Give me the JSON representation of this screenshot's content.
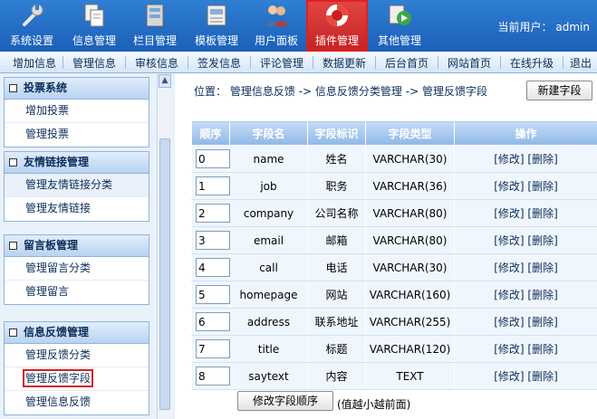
{
  "nav": {
    "items": [
      {
        "label": "系统设置",
        "icon": "wrench-icon"
      },
      {
        "label": "信息管理",
        "icon": "documents-icon"
      },
      {
        "label": "栏目管理",
        "icon": "column-icon"
      },
      {
        "label": "模板管理",
        "icon": "template-icon"
      },
      {
        "label": "用户面板",
        "icon": "users-icon"
      },
      {
        "label": "插件管理",
        "icon": "lifebuoy-icon"
      },
      {
        "label": "其他管理",
        "icon": "media-icon"
      }
    ],
    "active": "插件管理",
    "user_prefix": "当前用户：",
    "user_name": "admin"
  },
  "submenu": {
    "items": [
      "增加信息",
      "管理信息",
      "审核信息",
      "签发信息",
      "评论管理",
      "数据更新",
      "后台首页",
      "网站首页",
      "在线升级",
      "退出"
    ]
  },
  "sidebar": {
    "groups": [
      {
        "title": "投票系统",
        "items": [
          "增加投票",
          "管理投票"
        ]
      },
      {
        "title": "友情链接管理",
        "items": [
          "管理友情链接分类",
          "管理友情链接"
        ]
      },
      {
        "title": "留言板管理",
        "items": [
          "管理留言分类",
          "管理留言"
        ]
      },
      {
        "title": "信息反馈管理",
        "items": [
          "管理反馈分类",
          "管理反馈字段",
          "管理信息反馈"
        ]
      }
    ]
  },
  "content": {
    "position_label": "位置：",
    "breadcrumb": [
      "管理信息反馈",
      "信息反馈分类管理",
      "管理反馈字段"
    ],
    "breadcrumb_sep": " -> ",
    "new_field_button": "新建字段",
    "table": {
      "headers": [
        "顺序",
        "字段名",
        "字段标识",
        "字段类型",
        "操作"
      ],
      "rows": [
        {
          "order": "0",
          "name": "name",
          "label": "姓名",
          "type": "VARCHAR(30)"
        },
        {
          "order": "1",
          "name": "job",
          "label": "职务",
          "type": "VARCHAR(36)"
        },
        {
          "order": "2",
          "name": "company",
          "label": "公司名称",
          "type": "VARCHAR(80)"
        },
        {
          "order": "3",
          "name": "email",
          "label": "邮箱",
          "type": "VARCHAR(80)"
        },
        {
          "order": "4",
          "name": "call",
          "label": "电话",
          "type": "VARCHAR(30)"
        },
        {
          "order": "5",
          "name": "homepage",
          "label": "网站",
          "type": "VARCHAR(160)"
        },
        {
          "order": "6",
          "name": "address",
          "label": "联系地址",
          "type": "VARCHAR(255)"
        },
        {
          "order": "7",
          "name": "title",
          "label": "标题",
          "type": "VARCHAR(120)"
        },
        {
          "order": "8",
          "name": "saytext",
          "label": "内容",
          "type": "TEXT"
        }
      ],
      "edit_label": "[修改]",
      "delete_label": "[删除]"
    },
    "modify_order_button": "修改字段顺序",
    "order_note": "(值越小越前面)"
  },
  "colors": {
    "header_blue": "#1c5fb8",
    "active_red": "#c62222",
    "link_blue": "#0b2d5a"
  }
}
